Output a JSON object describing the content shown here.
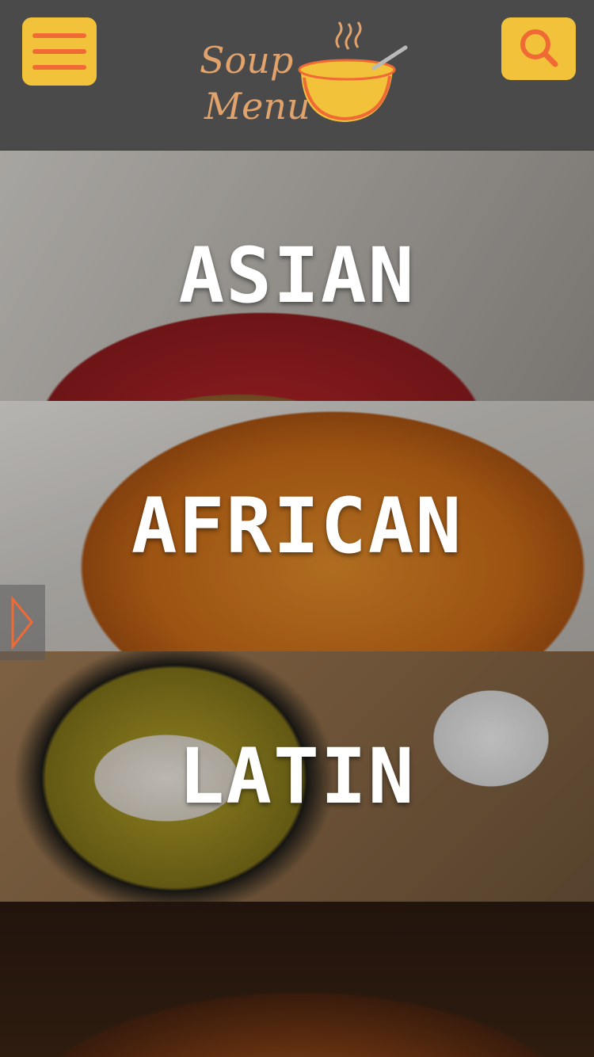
{
  "header": {
    "logo_line1": "Soup",
    "logo_line2": "Menu",
    "menu_icon": "hamburger-icon",
    "search_icon": "search-icon"
  },
  "categories": [
    {
      "label": "ASIAN"
    },
    {
      "label": "AFRICAN"
    },
    {
      "label": "LATIN"
    },
    {
      "label": ""
    }
  ],
  "side_tab": {
    "icon": "play-triangle-icon"
  },
  "colors": {
    "header_bg": "#4a4a4a",
    "button_bg": "#f2c23a",
    "accent_orange": "#f06a35",
    "logo_tan": "#e1a36b"
  }
}
